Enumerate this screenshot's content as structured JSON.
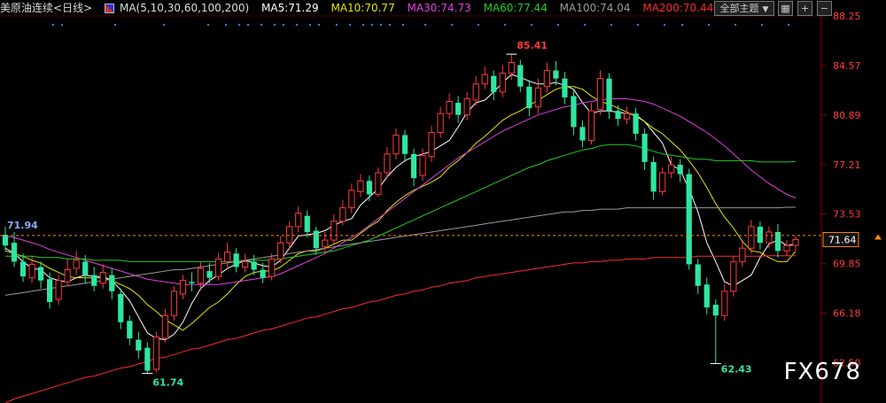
{
  "header": {
    "instrument": "美原油连续",
    "period": "<日线>",
    "ma_params": "MA(5,10,30,60,100,200)",
    "ma5": "MA5:71.29",
    "ma10": "MA10:70.77",
    "ma30": "MA30:74.73",
    "ma60": "MA60:77.44",
    "ma100": "MA100:74.04",
    "ma200": "MA200:70.44"
  },
  "toolbar": {
    "theme_select": "全部主题",
    "dropdown_icon": "triangle-down-icon",
    "grid_icon": "grid-icon",
    "plus_icon": "plus-icon",
    "minus_icon": "minus-icon"
  },
  "watermark": "FX678",
  "colors": {
    "up": "#ff3b3b",
    "down": "#2ee6a0",
    "ma5": "#ffffff",
    "ma10": "#e6e600",
    "ma30": "#e040e0",
    "ma60": "#22cc22",
    "ma100": "#9a9a9a",
    "ma200": "#ff2a2a",
    "axis_text": "#ff3b3b",
    "current_price_bg": "#ff8800"
  },
  "chart_data": {
    "type": "candlestick",
    "y_ticks": [
      "88.25",
      "84.57",
      "80.89",
      "77.21",
      "73.53",
      "69.85",
      "66.18",
      "62.50"
    ],
    "ylim": [
      59.5,
      88.25
    ],
    "current_price": "71.64",
    "annotations": {
      "high": "85.41",
      "low_left": "61.74",
      "low_right": "62.43",
      "ref_line": "71.94"
    },
    "candles": [
      [
        72.0,
        71.2,
        72.6,
        70.8
      ],
      [
        71.4,
        70.0,
        72.2,
        69.6
      ],
      [
        70.0,
        68.9,
        70.6,
        68.5
      ],
      [
        68.8,
        69.8,
        70.4,
        68.4
      ],
      [
        69.6,
        68.6,
        70.0,
        68.0
      ],
      [
        68.7,
        67.0,
        69.2,
        66.5
      ],
      [
        67.2,
        68.6,
        69.0,
        66.8
      ],
      [
        68.5,
        69.4,
        70.2,
        68.2
      ],
      [
        69.5,
        70.1,
        70.8,
        69.0
      ],
      [
        70.0,
        69.0,
        70.5,
        68.4
      ],
      [
        69.0,
        68.2,
        69.6,
        67.8
      ],
      [
        68.4,
        69.2,
        69.8,
        68.0
      ],
      [
        69.0,
        67.8,
        69.5,
        67.2
      ],
      [
        67.6,
        65.5,
        68.0,
        65.0
      ],
      [
        65.6,
        64.3,
        66.0,
        63.8
      ],
      [
        64.2,
        63.4,
        64.8,
        62.8
      ],
      [
        63.6,
        61.9,
        64.0,
        61.7
      ],
      [
        62.0,
        64.4,
        64.8,
        61.8
      ],
      [
        64.3,
        66.0,
        66.5,
        64.0
      ],
      [
        66.0,
        67.8,
        68.2,
        65.6
      ],
      [
        67.6,
        68.6,
        69.0,
        67.2
      ],
      [
        68.5,
        68.4,
        69.2,
        67.8
      ],
      [
        68.4,
        69.5,
        70.0,
        68.0
      ],
      [
        69.3,
        68.8,
        69.9,
        68.4
      ],
      [
        68.9,
        70.2,
        70.6,
        68.6
      ],
      [
        70.0,
        70.7,
        71.4,
        69.6
      ],
      [
        70.6,
        69.6,
        71.0,
        69.2
      ],
      [
        69.6,
        70.0,
        70.6,
        69.2
      ],
      [
        70.0,
        69.4,
        70.5,
        69.0
      ],
      [
        69.4,
        68.8,
        69.9,
        68.4
      ],
      [
        68.9,
        70.2,
        70.6,
        68.6
      ],
      [
        70.2,
        71.4,
        71.9,
        69.9
      ],
      [
        71.4,
        72.6,
        73.0,
        71.0
      ],
      [
        72.6,
        73.6,
        74.1,
        72.2
      ],
      [
        73.4,
        72.2,
        73.8,
        71.8
      ],
      [
        72.3,
        71.0,
        72.6,
        70.5
      ],
      [
        71.1,
        71.6,
        72.2,
        70.6
      ],
      [
        71.6,
        73.0,
        73.5,
        71.2
      ],
      [
        73.0,
        74.0,
        74.6,
        72.7
      ],
      [
        74.0,
        75.3,
        75.8,
        73.6
      ],
      [
        75.2,
        76.0,
        76.5,
        74.8
      ],
      [
        76.0,
        75.0,
        76.4,
        74.5
      ],
      [
        75.0,
        76.6,
        77.0,
        74.8
      ],
      [
        76.6,
        78.0,
        78.5,
        76.2
      ],
      [
        78.0,
        79.4,
        79.9,
        77.6
      ],
      [
        79.4,
        78.0,
        79.8,
        77.4
      ],
      [
        78.0,
        76.2,
        78.4,
        75.6
      ],
      [
        76.4,
        77.9,
        78.4,
        76.0
      ],
      [
        77.8,
        79.6,
        80.1,
        77.4
      ],
      [
        79.6,
        81.0,
        81.5,
        79.2
      ],
      [
        81.0,
        81.9,
        82.5,
        80.6
      ],
      [
        81.8,
        80.9,
        82.3,
        80.3
      ],
      [
        80.9,
        82.1,
        82.6,
        80.5
      ],
      [
        82.0,
        83.2,
        83.8,
        81.6
      ],
      [
        83.2,
        83.9,
        84.5,
        82.8
      ],
      [
        83.8,
        82.6,
        84.2,
        82.0
      ],
      [
        82.6,
        84.0,
        84.6,
        82.2
      ],
      [
        84.0,
        84.8,
        85.41,
        83.5
      ],
      [
        84.6,
        83.0,
        85.0,
        82.6
      ],
      [
        83.0,
        81.4,
        83.5,
        80.8
      ],
      [
        81.5,
        82.9,
        83.6,
        81.0
      ],
      [
        83.0,
        84.2,
        84.8,
        82.5
      ],
      [
        84.2,
        83.6,
        84.9,
        83.1
      ],
      [
        83.6,
        82.2,
        84.1,
        81.7
      ],
      [
        82.3,
        80.0,
        82.8,
        79.4
      ],
      [
        80.0,
        79.0,
        80.5,
        78.5
      ],
      [
        79.0,
        81.2,
        81.8,
        78.7
      ],
      [
        81.3,
        83.6,
        84.2,
        80.9
      ],
      [
        83.6,
        81.2,
        84.0,
        80.6
      ],
      [
        81.2,
        80.6,
        81.6,
        80.1
      ],
      [
        80.6,
        81.0,
        81.5,
        80.2
      ],
      [
        81.0,
        79.5,
        81.4,
        79.0
      ],
      [
        79.5,
        77.4,
        79.9,
        76.8
      ],
      [
        77.4,
        75.2,
        77.8,
        74.6
      ],
      [
        75.2,
        76.6,
        77.0,
        74.9
      ],
      [
        76.6,
        77.2,
        77.8,
        76.2
      ],
      [
        77.2,
        76.5,
        77.6,
        75.9
      ],
      [
        76.5,
        69.8,
        76.9,
        69.4
      ],
      [
        69.8,
        68.2,
        70.2,
        67.6
      ],
      [
        68.3,
        66.6,
        68.8,
        66.1
      ],
      [
        66.8,
        66.0,
        67.2,
        62.43
      ],
      [
        66.0,
        67.8,
        68.3,
        65.6
      ],
      [
        67.8,
        70.0,
        70.4,
        67.4
      ],
      [
        70.0,
        71.0,
        71.5,
        69.6
      ],
      [
        71.0,
        72.6,
        73.1,
        70.6
      ],
      [
        72.6,
        71.4,
        73.0,
        70.9
      ],
      [
        71.4,
        72.2,
        72.6,
        71.0
      ],
      [
        72.2,
        70.8,
        72.8,
        70.3
      ],
      [
        70.8,
        71.2,
        71.6,
        70.4
      ],
      [
        71.2,
        71.64,
        71.9,
        70.8
      ]
    ],
    "ma_series": {
      "MA5": [
        71.0,
        70.6,
        70.0,
        69.5,
        69.4,
        68.8,
        68.6,
        68.5,
        68.8,
        69.0,
        68.9,
        68.9,
        68.6,
        67.9,
        67.1,
        65.9,
        64.7,
        64.3,
        64.2,
        64.6,
        65.5,
        66.9,
        68.0,
        68.6,
        69.0,
        69.5,
        69.8,
        70.1,
        69.9,
        69.7,
        69.6,
        70.1,
        71.0,
        71.9,
        72.0,
        72.1,
        72.3,
        72.7,
        73.0,
        73.2,
        74.2,
        74.8,
        75.4,
        76.3,
        77.0,
        77.5,
        77.8,
        78.0,
        78.2,
        78.6,
        79.0,
        80.0,
        81.1,
        81.8,
        82.0,
        82.6,
        83.3,
        83.9,
        83.7,
        83.4,
        83.2,
        83.2,
        83.3,
        83.1,
        82.8,
        81.8,
        81.0,
        81.2,
        81.2,
        81.1,
        81.0,
        80.9,
        80.4,
        79.6,
        78.8,
        77.2,
        76.8,
        75.4,
        73.7,
        71.4,
        70.0,
        68.5,
        68.2,
        68.6,
        69.0,
        70.3,
        71.3,
        71.6,
        71.2,
        71.29
      ],
      "MA10": [
        70.8,
        70.6,
        70.4,
        70.1,
        69.9,
        69.5,
        69.2,
        68.9,
        68.8,
        68.8,
        68.8,
        68.8,
        68.6,
        68.3,
        68.0,
        67.5,
        66.8,
        66.3,
        65.7,
        65.3,
        64.9,
        65.4,
        66.0,
        66.6,
        67.0,
        67.6,
        68.3,
        68.9,
        69.2,
        69.3,
        69.3,
        69.6,
        70.1,
        70.6,
        70.8,
        70.8,
        71.0,
        71.3,
        71.6,
        71.6,
        72.1,
        72.6,
        73.0,
        73.8,
        74.4,
        74.9,
        75.3,
        75.6,
        75.9,
        76.3,
        77.0,
        77.5,
        78.1,
        78.8,
        79.3,
        79.9,
        80.5,
        80.9,
        81.2,
        81.6,
        82.0,
        82.4,
        82.8,
        83.0,
        83.0,
        82.8,
        82.3,
        81.9,
        81.7,
        81.4,
        81.1,
        80.8,
        80.4,
        79.9,
        79.5,
        78.9,
        78.3,
        77.5,
        76.6,
        75.5,
        74.3,
        73.3,
        72.5,
        71.5,
        70.8,
        70.7,
        70.3,
        70.0,
        70.0,
        70.77
      ],
      "MA30": [
        71.9,
        71.8,
        71.6,
        71.4,
        71.2,
        70.9,
        70.7,
        70.5,
        70.3,
        70.1,
        69.9,
        69.7,
        69.5,
        69.3,
        69.1,
        68.9,
        68.7,
        68.6,
        68.5,
        68.4,
        68.3,
        68.3,
        68.3,
        68.3,
        68.3,
        68.4,
        68.5,
        68.6,
        68.7,
        68.8,
        68.9,
        69.1,
        69.4,
        69.7,
        70.0,
        70.3,
        70.6,
        71.0,
        71.4,
        71.8,
        72.2,
        72.7,
        73.2,
        73.7,
        74.2,
        74.7,
        75.2,
        75.7,
        76.2,
        76.7,
        77.2,
        77.7,
        78.1,
        78.5,
        78.9,
        79.3,
        79.7,
        80.0,
        80.3,
        80.6,
        80.9,
        81.1,
        81.3,
        81.5,
        81.6,
        81.8,
        81.9,
        82.0,
        82.1,
        82.1,
        82.1,
        82.0,
        81.9,
        81.7,
        81.4,
        81.1,
        80.8,
        80.4,
        80.0,
        79.6,
        79.1,
        78.6,
        78.0,
        77.4,
        76.8,
        76.3,
        75.8,
        75.4,
        75.0,
        74.73
      ],
      "MA60": [
        70.4,
        70.4,
        70.4,
        70.4,
        70.3,
        70.3,
        70.3,
        70.2,
        70.2,
        70.2,
        70.1,
        70.1,
        70.1,
        70.1,
        70.0,
        70.0,
        70.0,
        70.0,
        70.0,
        70.0,
        70.0,
        70.0,
        70.0,
        70.0,
        70.0,
        70.0,
        70.0,
        70.1,
        70.1,
        70.1,
        70.1,
        70.2,
        70.3,
        70.4,
        70.5,
        70.6,
        70.7,
        70.8,
        71.0,
        71.2,
        71.4,
        71.6,
        71.9,
        72.2,
        72.5,
        72.8,
        73.1,
        73.4,
        73.7,
        74.0,
        74.3,
        74.6,
        74.9,
        75.2,
        75.5,
        75.8,
        76.1,
        76.4,
        76.7,
        77.0,
        77.2,
        77.5,
        77.7,
        77.9,
        78.1,
        78.3,
        78.4,
        78.6,
        78.7,
        78.7,
        78.7,
        78.6,
        78.4,
        78.2,
        78.0,
        77.9,
        77.8,
        77.7,
        77.6,
        77.6,
        77.5,
        77.5,
        77.5,
        77.5,
        77.5,
        77.4,
        77.4,
        77.4,
        77.4,
        77.44
      ],
      "MA100": [
        67.5,
        67.6,
        67.7,
        67.8,
        67.9,
        68.0,
        68.1,
        68.2,
        68.3,
        68.4,
        68.5,
        68.6,
        68.7,
        68.8,
        68.9,
        69.0,
        69.1,
        69.2,
        69.3,
        69.4,
        69.4,
        69.5,
        69.6,
        69.7,
        69.8,
        69.9,
        70.0,
        70.1,
        70.2,
        70.3,
        70.4,
        70.5,
        70.6,
        70.7,
        70.8,
        70.9,
        71.0,
        71.1,
        71.2,
        71.3,
        71.4,
        71.5,
        71.6,
        71.7,
        71.8,
        71.9,
        72.0,
        72.1,
        72.2,
        72.3,
        72.4,
        72.5,
        72.6,
        72.7,
        72.8,
        72.9,
        73.0,
        73.1,
        73.2,
        73.3,
        73.4,
        73.5,
        73.6,
        73.7,
        73.7,
        73.8,
        73.8,
        73.9,
        73.9,
        73.9,
        74.0,
        74.0,
        74.0,
        74.0,
        74.0,
        74.0,
        74.0,
        74.0,
        74.0,
        74.0,
        74.0,
        74.0,
        74.0,
        74.0,
        74.0,
        74.0,
        74.0,
        74.0,
        74.04,
        74.04
      ],
      "MA200": [
        59.5,
        59.8,
        60.0,
        60.2,
        60.4,
        60.6,
        60.8,
        61.0,
        61.2,
        61.4,
        61.5,
        61.7,
        61.9,
        62.1,
        62.2,
        62.4,
        62.6,
        62.8,
        62.9,
        63.1,
        63.3,
        63.5,
        63.6,
        63.8,
        64.0,
        64.2,
        64.3,
        64.5,
        64.7,
        64.9,
        65.0,
        65.2,
        65.4,
        65.6,
        65.8,
        65.9,
        66.1,
        66.3,
        66.5,
        66.6,
        66.8,
        67.0,
        67.1,
        67.3,
        67.5,
        67.6,
        67.8,
        67.9,
        68.1,
        68.2,
        68.4,
        68.5,
        68.6,
        68.8,
        68.9,
        69.0,
        69.1,
        69.2,
        69.3,
        69.4,
        69.5,
        69.6,
        69.7,
        69.8,
        69.9,
        69.9,
        70.0,
        70.0,
        70.1,
        70.1,
        70.2,
        70.2,
        70.2,
        70.3,
        70.3,
        70.3,
        70.3,
        70.3,
        70.4,
        70.4,
        70.4,
        70.4,
        70.4,
        70.4,
        70.4,
        70.4,
        70.44,
        70.44,
        70.44,
        70.44
      ]
    }
  }
}
